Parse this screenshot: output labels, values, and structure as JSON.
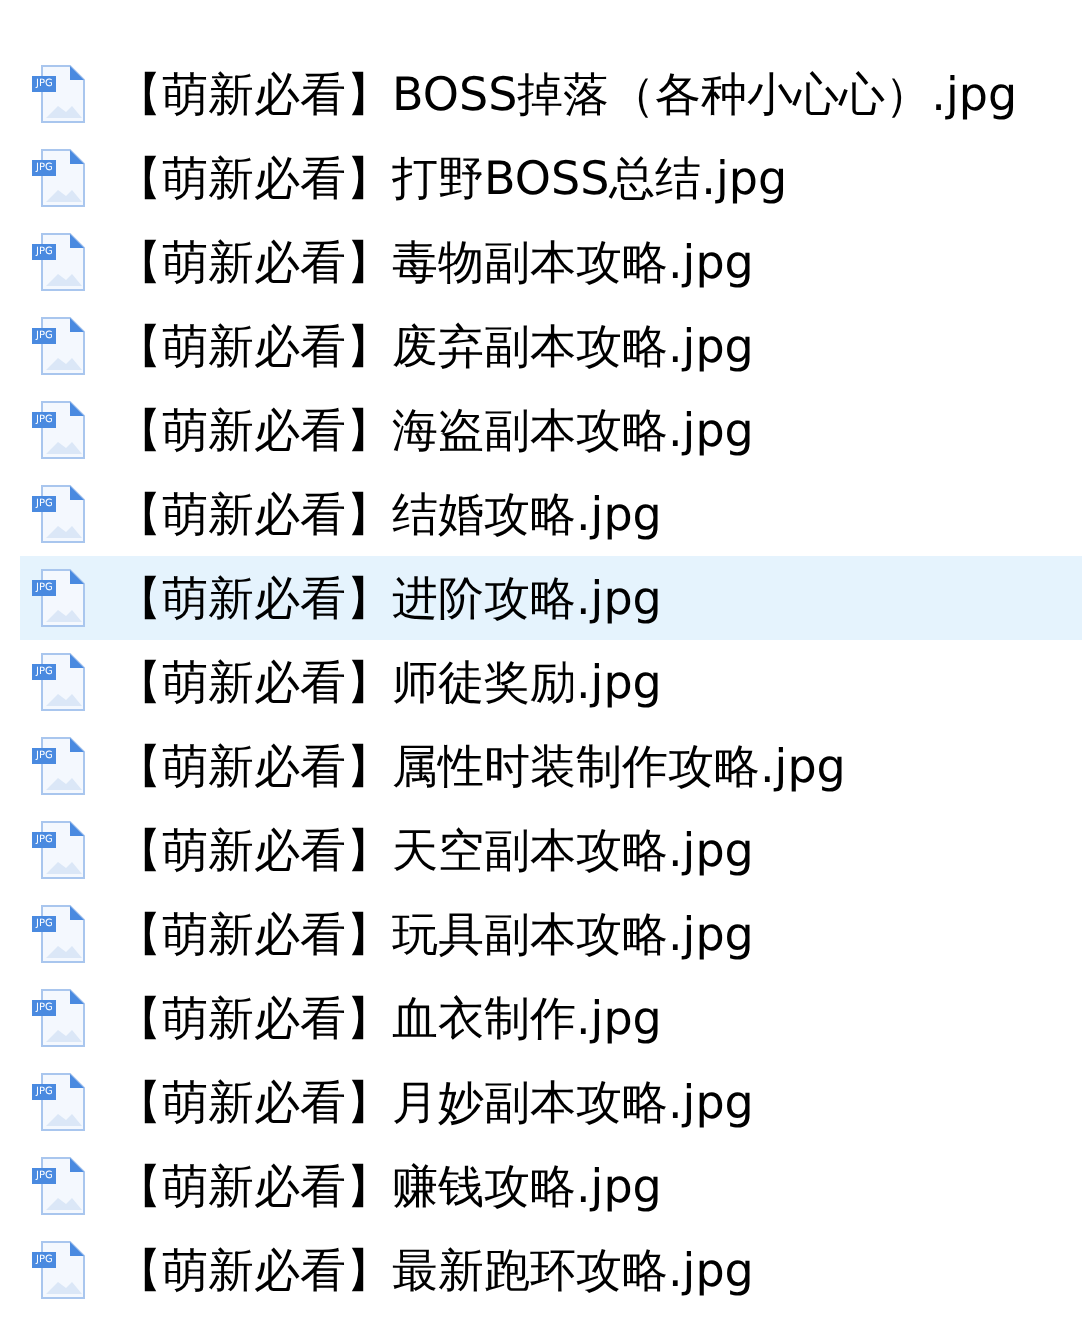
{
  "files": [
    {
      "name": "【萌新必看】BOSS掉落（各种小心心）.jpg",
      "badge": "JPG",
      "selected": false
    },
    {
      "name": "【萌新必看】打野BOSS总结.jpg",
      "badge": "JPG",
      "selected": false
    },
    {
      "name": "【萌新必看】毒物副本攻略.jpg",
      "badge": "JPG",
      "selected": false
    },
    {
      "name": "【萌新必看】废弃副本攻略.jpg",
      "badge": "JPG",
      "selected": false
    },
    {
      "name": "【萌新必看】海盗副本攻略.jpg",
      "badge": "JPG",
      "selected": false
    },
    {
      "name": "【萌新必看】结婚攻略.jpg",
      "badge": "JPG",
      "selected": false
    },
    {
      "name": "【萌新必看】进阶攻略.jpg",
      "badge": "JPG",
      "selected": true
    },
    {
      "name": "【萌新必看】师徒奖励.jpg",
      "badge": "JPG",
      "selected": false
    },
    {
      "name": "【萌新必看】属性时装制作攻略.jpg",
      "badge": "JPG",
      "selected": false
    },
    {
      "name": "【萌新必看】天空副本攻略.jpg",
      "badge": "JPG",
      "selected": false
    },
    {
      "name": "【萌新必看】玩具副本攻略.jpg",
      "badge": "JPG",
      "selected": false
    },
    {
      "name": "【萌新必看】血衣制作.jpg",
      "badge": "JPG",
      "selected": false
    },
    {
      "name": "【萌新必看】月妙副本攻略.jpg",
      "badge": "JPG",
      "selected": false
    },
    {
      "name": "【萌新必看】赚钱攻略.jpg",
      "badge": "JPG",
      "selected": false
    },
    {
      "name": "【萌新必看】最新跑环攻略.jpg",
      "badge": "JPG",
      "selected": false
    }
  ]
}
